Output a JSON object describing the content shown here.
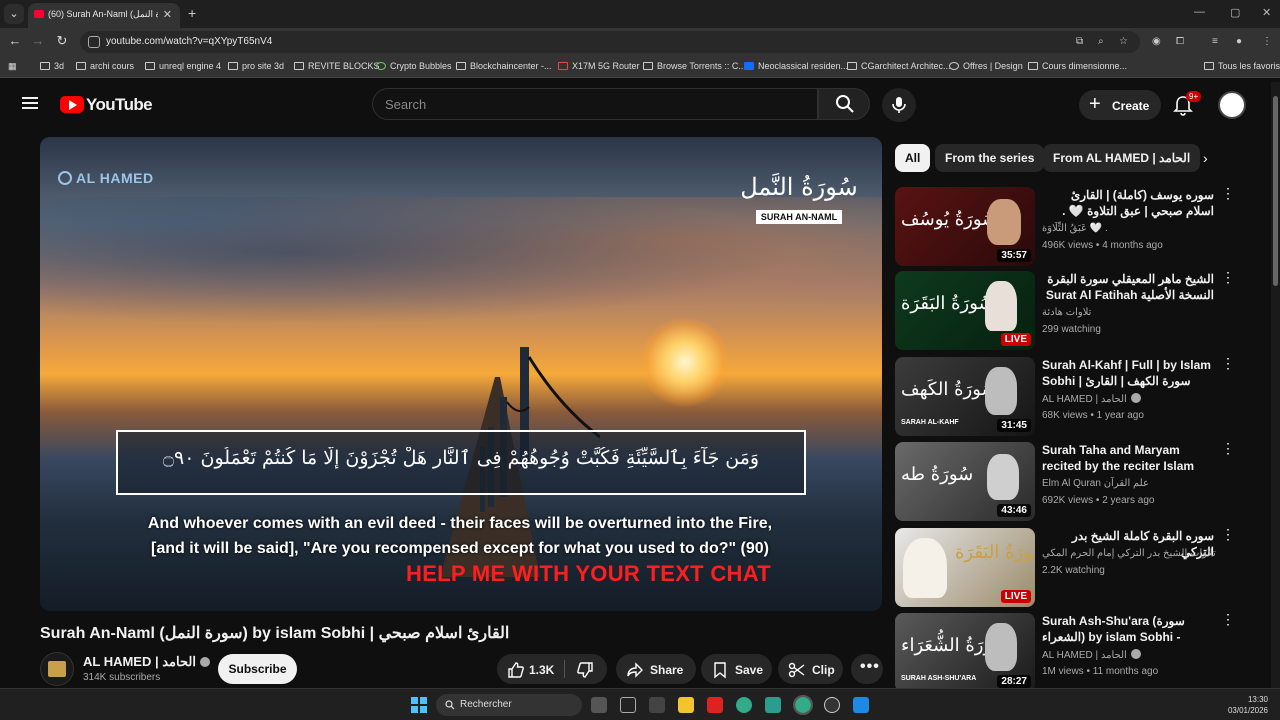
{
  "browser": {
    "tab_title": "(60) Surah An-Naml (سورة النمل) by islam Sobhi",
    "url": "youtube.com/watch?v=qXYpyT65nV4",
    "bookmarks": [
      "3d",
      "archi cours",
      "unreql engine 4",
      "pro site 3d",
      "REVITE BLOCKS",
      "Crypto Bubbles",
      "Blockchaincenter -...",
      "X17M 5G Router",
      "Browse Torrents :: C...",
      "Neoclassical residen...",
      "CGarchitect Architec...",
      "Offres | Design",
      "Cours dimensionne..."
    ],
    "all_bookmarks": "Tous les favoris"
  },
  "header": {
    "logo": "YouTube",
    "search_placeholder": "Search",
    "create_label": "Create",
    "notifications_badge": "9+"
  },
  "player": {
    "watermark": "AL HAMED",
    "surah_logo_ar": "سُورَةُ النَّمل",
    "surah_logo_en": "SURAH AN-NAML",
    "verse_ar": "وَمَن جَآءَ بِٱلسَّيِّئَةِ فَكُبَّتْ وُجُوهُهُمْ فِى ٱلنَّارِ هَلْ تُجْزَوْنَ إِلَّا مَا كُنتُمْ تَعْمَلُونَ ۝٩٠",
    "translation": "And whoever comes with an evil deed - their faces will be overturned into the Fire, [and it will be said], \"Are you recompensed except for what you used to do?\" (90)",
    "help_text": "HELP ME WITH YOUR TEXT CHAT"
  },
  "video": {
    "title": "Surah An-Naml (سورة النمل) by islam Sobhi | القارئ اسلام صبحي",
    "channel": "AL HAMED | الحامد",
    "subscribers": "314K subscribers",
    "subscribe_label": "Subscribe",
    "likes": "1.3K",
    "share_label": "Share",
    "save_label": "Save",
    "clip_label": "Clip"
  },
  "chips": [
    "All",
    "From the series",
    "From AL HAMED | الحامد"
  ],
  "recommendations": [
    {
      "title": "سوره يوسف (كاملة) | القارئ اسلام صبحي | عبق التلاوة 🤍 .",
      "channel": "عَبَقُ التِّلَاوَة 🤍 .",
      "meta": "496K views • 4 months ago",
      "badge": "35:57",
      "live": false,
      "thumb_ar": "سُورَةُ يُوسُف",
      "thumb_en": "",
      "colors": [
        "#5a1212",
        "#2a0a0a"
      ]
    },
    {
      "title": "الشيخ ماهر المعيقلي سورة البقرة النسخة الأصلية Surat Al Fatihah Official ...",
      "channel": "تلاوات هادئة",
      "meta": "299 watching",
      "badge": "LIVE",
      "live": true,
      "thumb_ar": "سُورَةُ البَقَرَة",
      "thumb_en": "",
      "colors": [
        "#0e3a1e",
        "#06200f"
      ]
    },
    {
      "title": "Surah Al-Kahf | Full | by Islam Sobhi | سورة الكهف | القارئ اسلام صبحي",
      "channel": "AL HAMED | الحامد",
      "meta": "68K views • 1 year ago",
      "badge": "31:45",
      "live": false,
      "thumb_ar": "سُورَةُ الكَهف",
      "thumb_en": "SARAH AL-KAHF",
      "colors": [
        "#3c3c3c",
        "#151515"
      ]
    },
    {
      "title": "Surah Taha and Maryam recited by the reciter Islam Sobhi || ...",
      "channel": "Elm Al Quran علم القرآن",
      "meta": "692K views • 2 years ago",
      "badge": "43:46",
      "live": false,
      "thumb_ar": "سُورَةُ طه",
      "thumb_en": "",
      "colors": [
        "#6a6a6a",
        "#2a2a2a"
      ]
    },
    {
      "title": "سوره البقرة كاملة الشيخ بدر التركي",
      "channel": "تلاوات الشيخ بدر التركي إمام الحرم المكي",
      "meta": "2.2K watching",
      "badge": "LIVE",
      "live": true,
      "thumb_ar": "سُورَةُ البَقَرَة",
      "thumb_en": "",
      "colors": [
        "#e8e8e8",
        "#9a8a6a"
      ]
    },
    {
      "title": "Surah Ash-Shu'ara (سورة الشعراء) by islam Sobhi - القارئ اسلام صبحي",
      "channel": "AL HAMED | الحامد",
      "meta": "1M views • 11 months ago",
      "badge": "28:27",
      "live": false,
      "thumb_ar": "سُورَةُ الشُّعَرَاء",
      "thumb_en": "SURAH ASH-SHU'ARA",
      "colors": [
        "#5a5a5a",
        "#1a1a1a"
      ]
    }
  ],
  "taskbar": {
    "search_label": "Rechercher",
    "time": "13:30",
    "date": "03/01/2026"
  }
}
